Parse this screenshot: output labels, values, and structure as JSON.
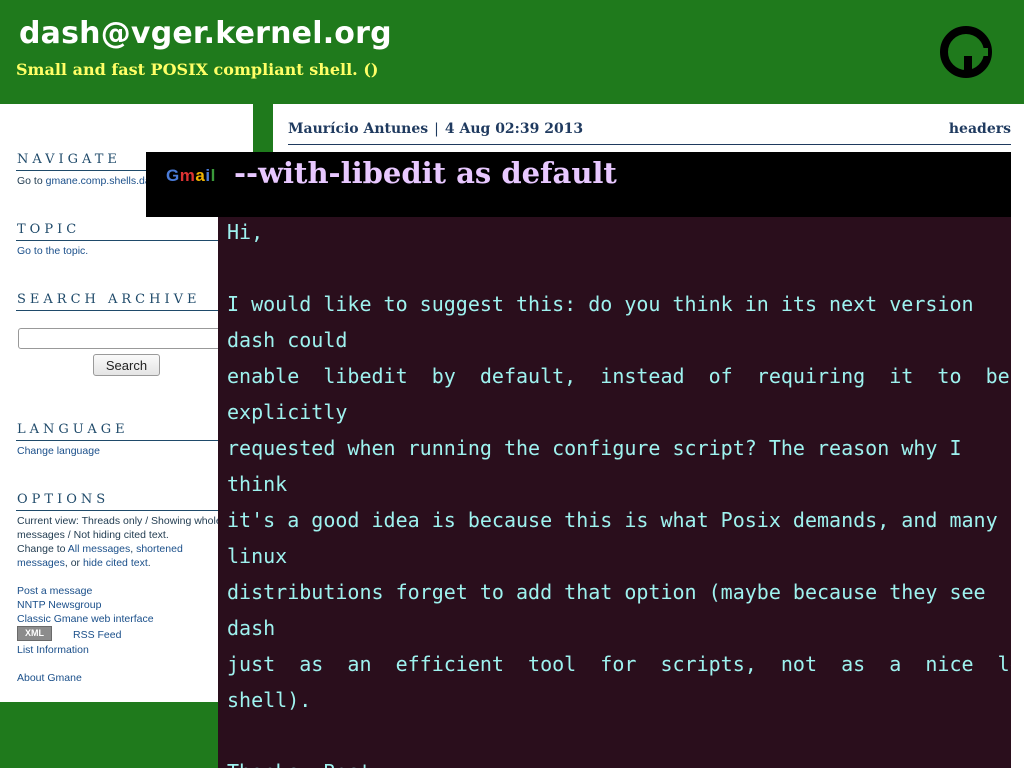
{
  "header": {
    "title": "dash@vger.kernel.org",
    "subtitle": "Small and fast POSIX compliant shell. ()",
    "logo_icon": "gmane-logo-icon"
  },
  "sidebar": {
    "navigate": {
      "title": "NAVIGATE",
      "goto_prefix": "Go to ",
      "goto_link": "gmane.comp.shells.dash"
    },
    "topic": {
      "title": "TOPIC",
      "link": "Go to the topic."
    },
    "search": {
      "title": "SEARCH ARCHIVE",
      "input_value": "",
      "button_label": "Search"
    },
    "language": {
      "title": "LANGUAGE",
      "link": "Change language"
    },
    "options": {
      "title": "OPTIONS",
      "current_view_line1": "Current view: Threads only / Showing whole",
      "current_view_line2": "messages / Not hiding cited text.",
      "change_to_prefix": "Change to ",
      "change_all": "All messages",
      "change_sep": ", ",
      "change_shortened": "shortened",
      "change_messages": "messages",
      "change_or": ", or ",
      "change_hide": "hide cited text",
      "change_end": ".",
      "post_message": "Post a message",
      "nntp": "NNTP Newsgroup",
      "classic": "Classic Gmane web interface",
      "xml_badge": "XML",
      "rss": "RSS Feed",
      "list_info": "List Information",
      "about": "About Gmane"
    }
  },
  "message": {
    "author": "Maurício Antunes",
    "separator": "|",
    "date": "4 Aug 02:39 2013",
    "headers_link": "headers",
    "subject": "--with-libedit as default",
    "gmail_logo": "Gmail",
    "body_lines": [
      "Hi,",
      "",
      "I would like to suggest this: do you think in its next version",
      "dash could",
      "enable  libedit  by  default,  instead  of  requiring  it  to  be",
      "explicitly",
      "requested when running the configure script? The reason why I",
      "think",
      "it's a good idea is because this is what Posix demands, and many",
      "linux",
      "distributions forget to add that option (maybe because they see",
      "dash",
      "just  as  an  efficient  tool  for  scripts,  not  as  a  nice  login",
      "shell).",
      "",
      "Thanks, Best"
    ]
  },
  "colors": {
    "header_green": "#1f7a1c",
    "subtitle_yellow": "#ffff66",
    "body_bg": "#2a0e1c",
    "body_text": "#9ef2ef",
    "subject_text": "#e8c8ff"
  }
}
